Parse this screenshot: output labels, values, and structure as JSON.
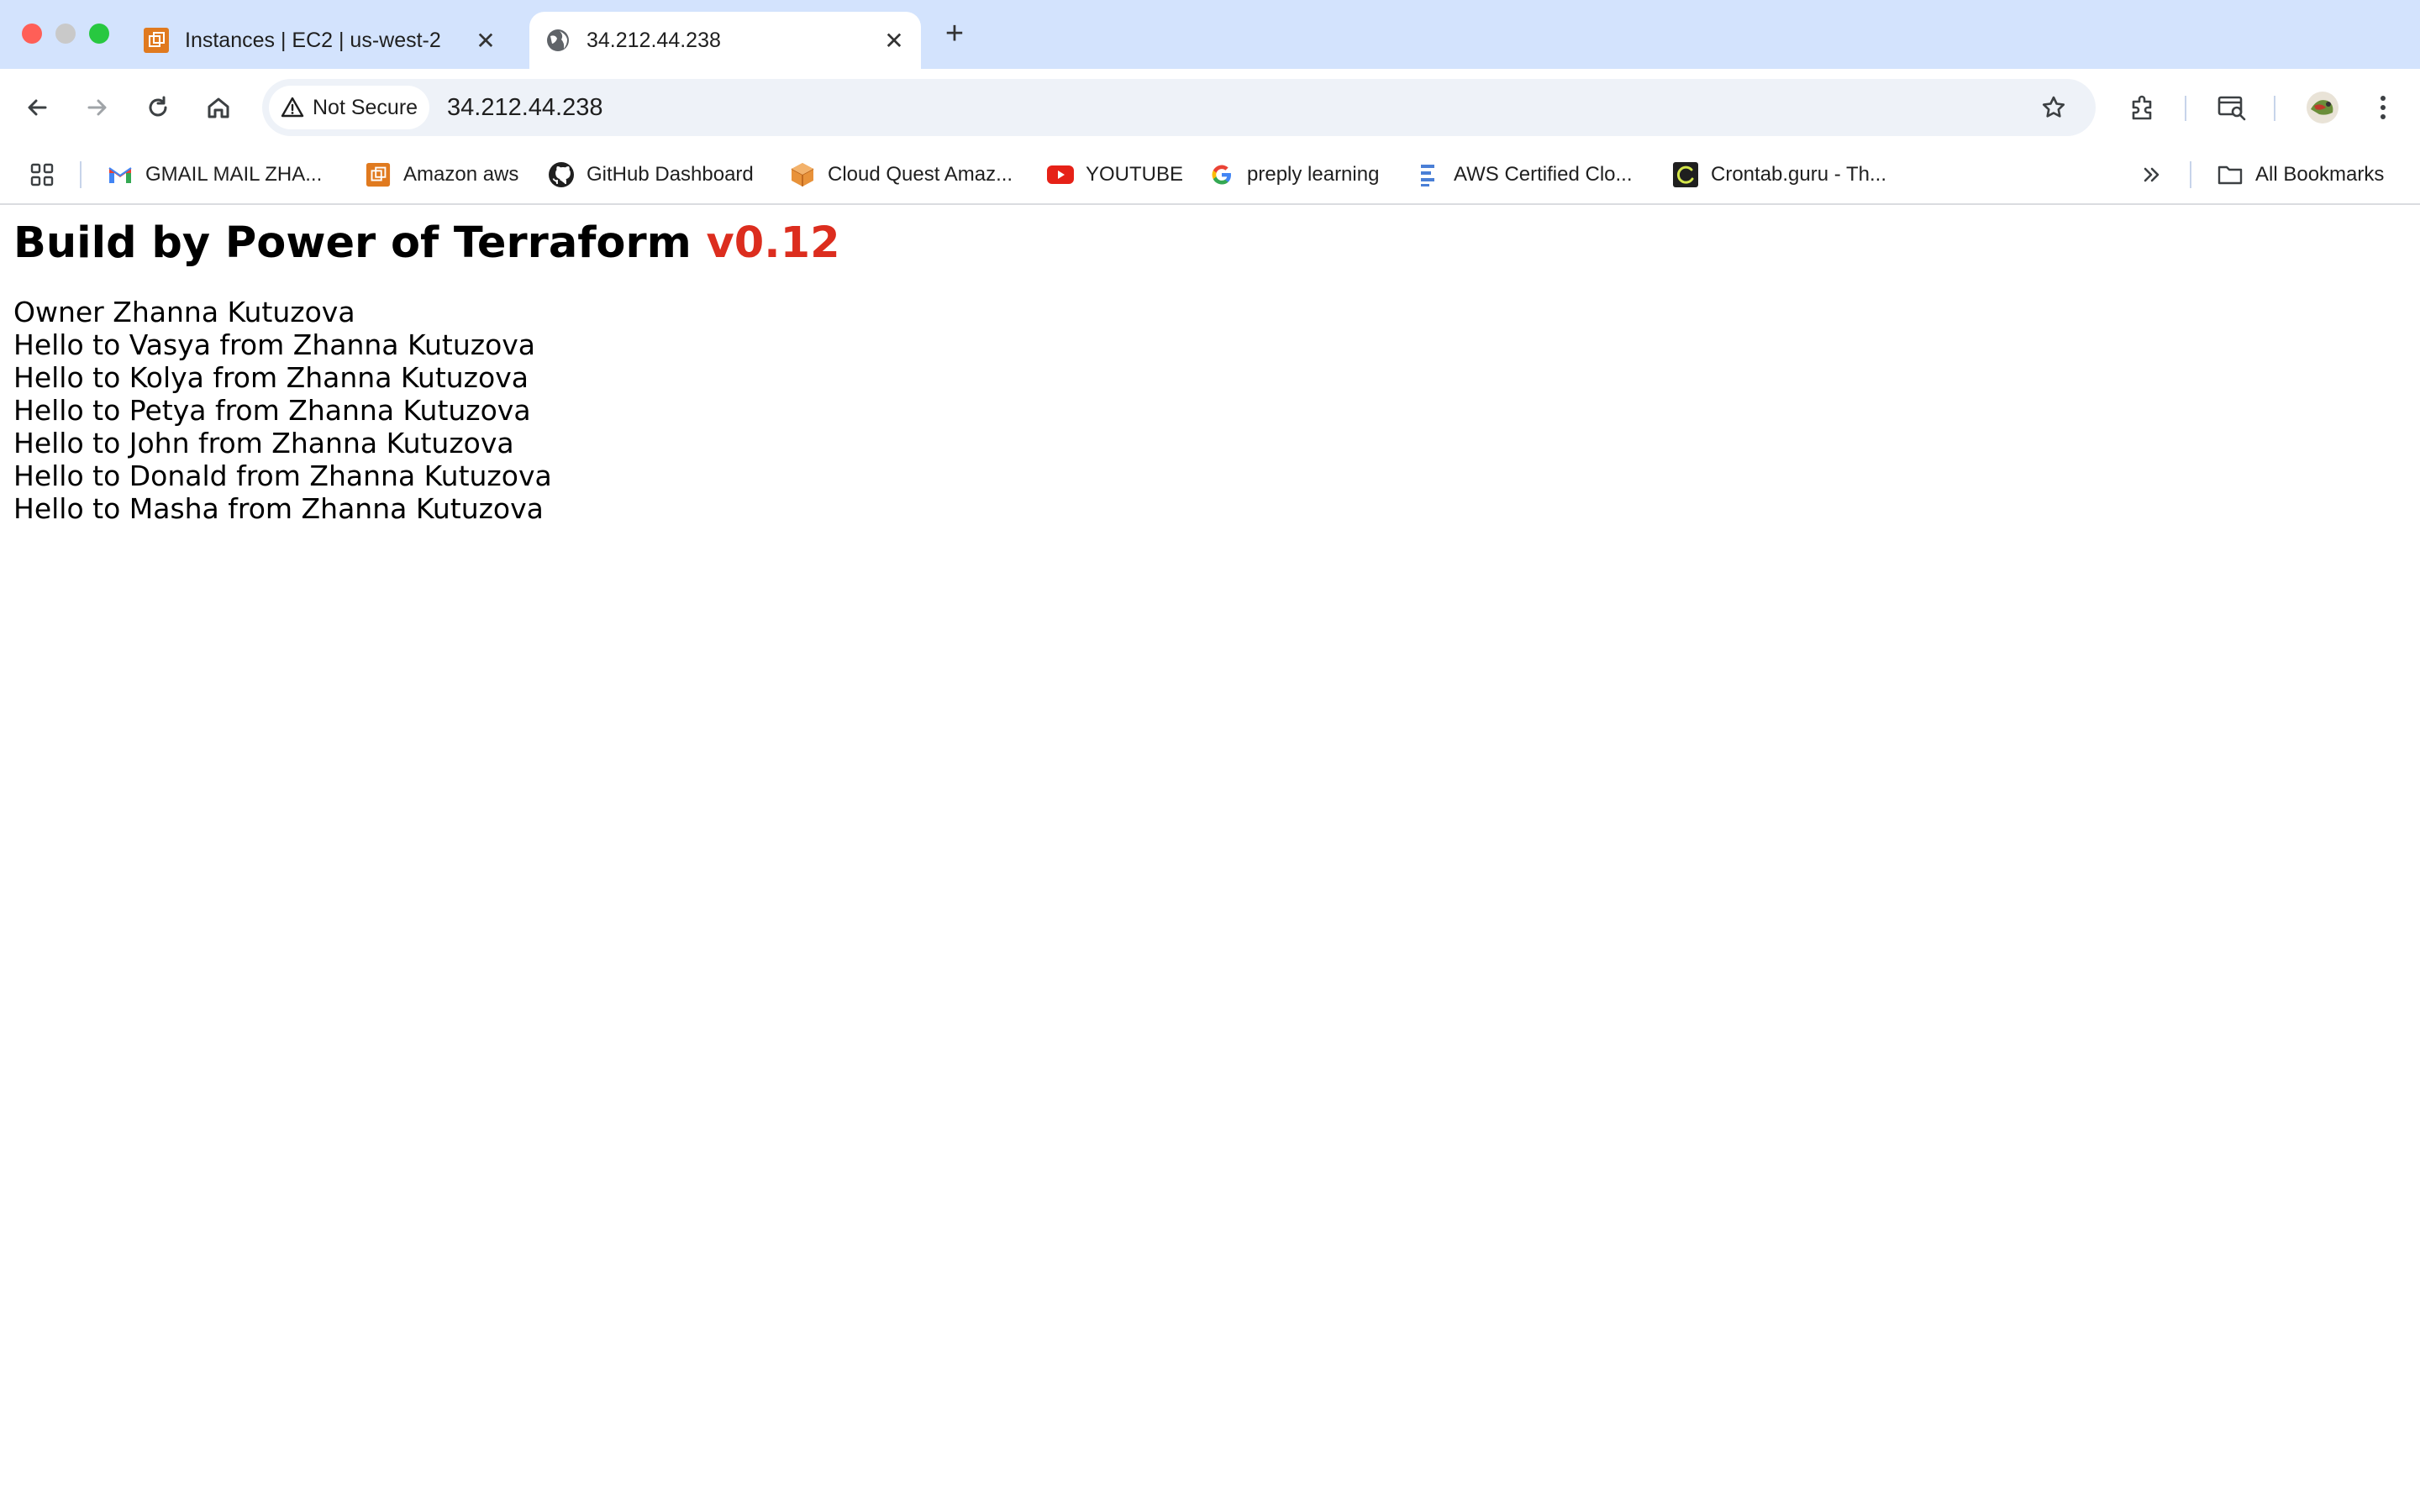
{
  "window": {
    "tabs": [
      {
        "title": "Instances | EC2 | us-west-2",
        "icon": "aws-ec2-icon",
        "active": false
      },
      {
        "title": "34.212.44.238",
        "icon": "globe-icon",
        "active": true
      }
    ]
  },
  "toolbar": {
    "security_label": "Not Secure",
    "url": "34.212.44.238"
  },
  "bookmarks": {
    "items": [
      {
        "label": "GMAIL MAIL ZHA...",
        "icon": "gmail-icon"
      },
      {
        "label": "Amazon aws",
        "icon": "aws-icon"
      },
      {
        "label": "GitHub Dashboard",
        "icon": "github-icon"
      },
      {
        "label": "Cloud Quest Amaz...",
        "icon": "cube-icon"
      },
      {
        "label": "YOUTUBE",
        "icon": "youtube-icon"
      },
      {
        "label": "preply learning",
        "icon": "google-icon"
      },
      {
        "label": "AWS Certified Clo...",
        "icon": "bars-icon"
      },
      {
        "label": "Crontab.guru - Th...",
        "icon": "crontab-icon"
      }
    ],
    "all_bookmarks_label": "All Bookmarks"
  },
  "page": {
    "heading": "Build by Power of Terraform ",
    "version": "v0.12",
    "lines": [
      "Owner Zhanna Kutuzova",
      "Hello to Vasya from Zhanna Kutuzova",
      "Hello to Kolya from Zhanna Kutuzova",
      "Hello to Petya from Zhanna Kutuzova",
      "Hello to John from Zhanna Kutuzova",
      "Hello to Donald from Zhanna Kutuzova",
      "Hello to Masha from Zhanna Kutuzova"
    ]
  },
  "colors": {
    "tabstrip_bg": "#d3e3fd",
    "version_red": "#dc2d1e"
  }
}
